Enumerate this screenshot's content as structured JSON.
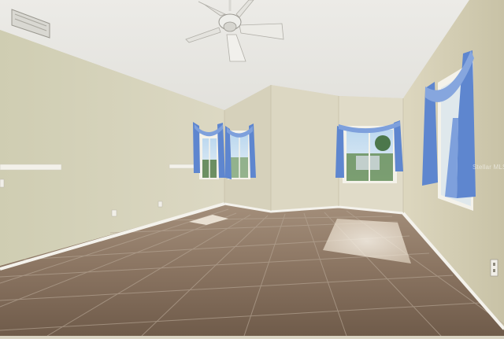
{
  "image": {
    "subject": "empty-room-photo",
    "watermark_text": "Stellar MLS",
    "colors": {
      "ceiling": "#e9e8e4",
      "wall_left": "#d2cfb6",
      "wall_back": "#ddd8c4",
      "wall_right": "#cfcab0",
      "baseboard": "#f4f2ec",
      "tile": "#8a7461",
      "grout": "#b7a898",
      "curtain": "#5e86cf",
      "window_sky": "#9cc2e6",
      "foliage": "#4f7a45"
    }
  }
}
